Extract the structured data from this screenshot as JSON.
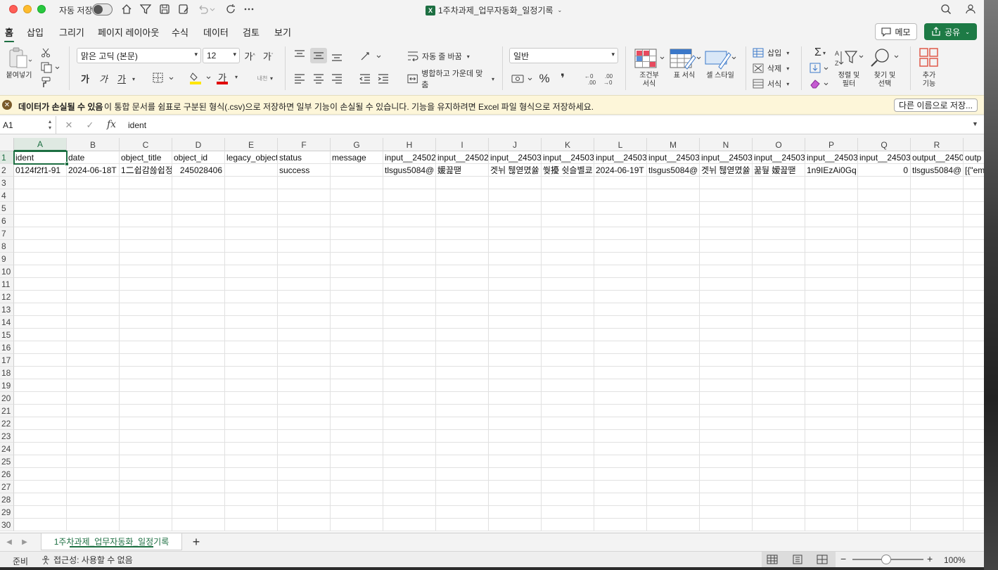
{
  "titlebar": {
    "autosave_label": "자동 저장",
    "doc_title": "1주차과제_업무자동화_일정기록",
    "excel_badge": "X"
  },
  "ribbon_tabs": [
    "홈",
    "삽입",
    "그리기",
    "페이지 레이아웃",
    "수식",
    "데이터",
    "검토",
    "보기"
  ],
  "memo_label": "메모",
  "share_label": "공유",
  "ribbon": {
    "paste_label": "붙여넣기",
    "font_name": "맑은 고딕 (본문)",
    "font_size": "12",
    "grow_font": "가",
    "shrink_font": "가",
    "bold": "가",
    "italic": "가",
    "underline": "가",
    "font_color_glyph": "가",
    "phonetic": "내천",
    "wrap_text": "자동 줄 바꿈",
    "merge_center": "병합하고 가운데 맞춤",
    "number_format": "일반",
    "percent": "%",
    "comma": "❜",
    "conditional_format": "조건부\n서식",
    "format_as_table": "표 서식",
    "cell_styles": "셀 스타일",
    "insert": "삽입",
    "delete": "삭제",
    "format": "서식",
    "sort_filter": "정렬 및\n필터",
    "find_select": "찾기 및\n선택",
    "addins": "추가\n기능",
    "colors": {
      "fill_bar": "#ffe600",
      "font_bar": "#e00000"
    }
  },
  "message_bar": {
    "title": "데이터가 손실될 수 있음",
    "text": "이 통합 문서를 쉼표로 구분된 형식(.csv)으로 저장하면 일부 기능이 손실될 수 있습니다. 기능을 유지하려면 Excel 파일 형식으로 저장하세요.",
    "button": "다른 이름으로 저장..."
  },
  "formula_bar": {
    "name_box": "A1",
    "fx": "fx",
    "value": "ident"
  },
  "grid": {
    "columns": [
      "A",
      "B",
      "C",
      "D",
      "E",
      "F",
      "G",
      "H",
      "I",
      "J",
      "K",
      "L",
      "M",
      "N",
      "O",
      "P",
      "Q",
      "R"
    ],
    "row_numbers": [
      "1",
      "2",
      "3",
      "4",
      "5",
      "6",
      "7",
      "8",
      "9",
      "10",
      "11",
      "12",
      "13",
      "14",
      "15",
      "16",
      "17",
      "18",
      "19",
      "20",
      "21",
      "22",
      "23",
      "24",
      "25",
      "26",
      "27",
      "28",
      "29",
      "30"
    ],
    "rows": [
      [
        "ident",
        "date",
        "object_title",
        "object_id",
        "legacy_object",
        "status",
        "message",
        "input__24502",
        "input__24502",
        "input__24503",
        "input__24503",
        "input__24503",
        "input__24503",
        "input__24503",
        "input__24503",
        "input__24503",
        "input__24503",
        "output__2450",
        "outp"
      ],
      [
        "0124f2f1-91",
        "2024-06-18T",
        "1二쉽감쓚쉽정",
        "245028406",
        "",
        "success",
        "",
        "tlsgus5084@",
        "媛끒땓",
        "겟뉘 퉪엳몄쓣",
        "쒖擾 쉿슬벨쿄",
        "2024-06-19T",
        "tlsgus5084@",
        "겟뉘 퉪엳몄쓣",
        "꿂뒆 嫒끒땓",
        "1n9IEzAi0Gq",
        "0",
        "tlsgus5084@",
        "[{\"em"
      ]
    ]
  },
  "sheet_tab": "1주차과제_업무자동화_일정기록",
  "add_sheet": "+",
  "status": {
    "ready": "준비",
    "accessibility": "접근성: 사용할 수 없음",
    "zoom": "100%",
    "minus": "−",
    "plus": "+"
  }
}
